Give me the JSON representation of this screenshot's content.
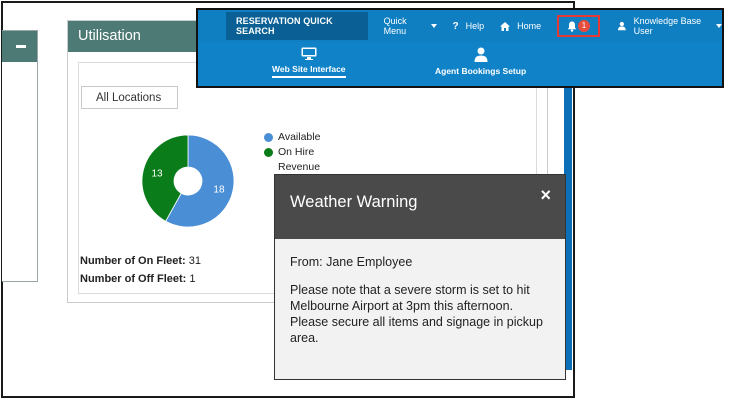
{
  "utilisation": {
    "title": "Utilisation",
    "location_select": "All Locations",
    "chart_data": {
      "type": "pie",
      "categories": [
        "Available",
        "On Hire"
      ],
      "values": [
        18,
        13
      ],
      "colors": [
        "#4a8fd6",
        "#0a7d1a"
      ]
    },
    "legend": [
      {
        "label": "Available",
        "color": "#4a8fd6"
      },
      {
        "label": "On Hire",
        "color": "#0a7d1a"
      }
    ],
    "legend_extra": "Revenue",
    "on_fleet_label": "Number of On Fleet:",
    "on_fleet_value": "31",
    "off_fleet_label": "Number of Off Fleet:",
    "off_fleet_value": "1"
  },
  "nav": {
    "quick_search": "RESERVATION QUICK SEARCH",
    "quick_menu": "Quick Menu",
    "help": "Help",
    "home": "Home",
    "notification_count": "1",
    "user": "Knowledge Base User",
    "sub_items": [
      {
        "label": "Web Site Interface",
        "icon": "monitor-icon"
      },
      {
        "label": "Agent Bookings Setup",
        "icon": "agent-icon"
      }
    ]
  },
  "modal": {
    "title": "Weather Warning",
    "close": "×",
    "from": "From: Jane Employee",
    "message": "Please note that a severe storm is set to hit Melbourne Airport at 3pm this afternoon. Please secure all items and signage in pickup area."
  }
}
